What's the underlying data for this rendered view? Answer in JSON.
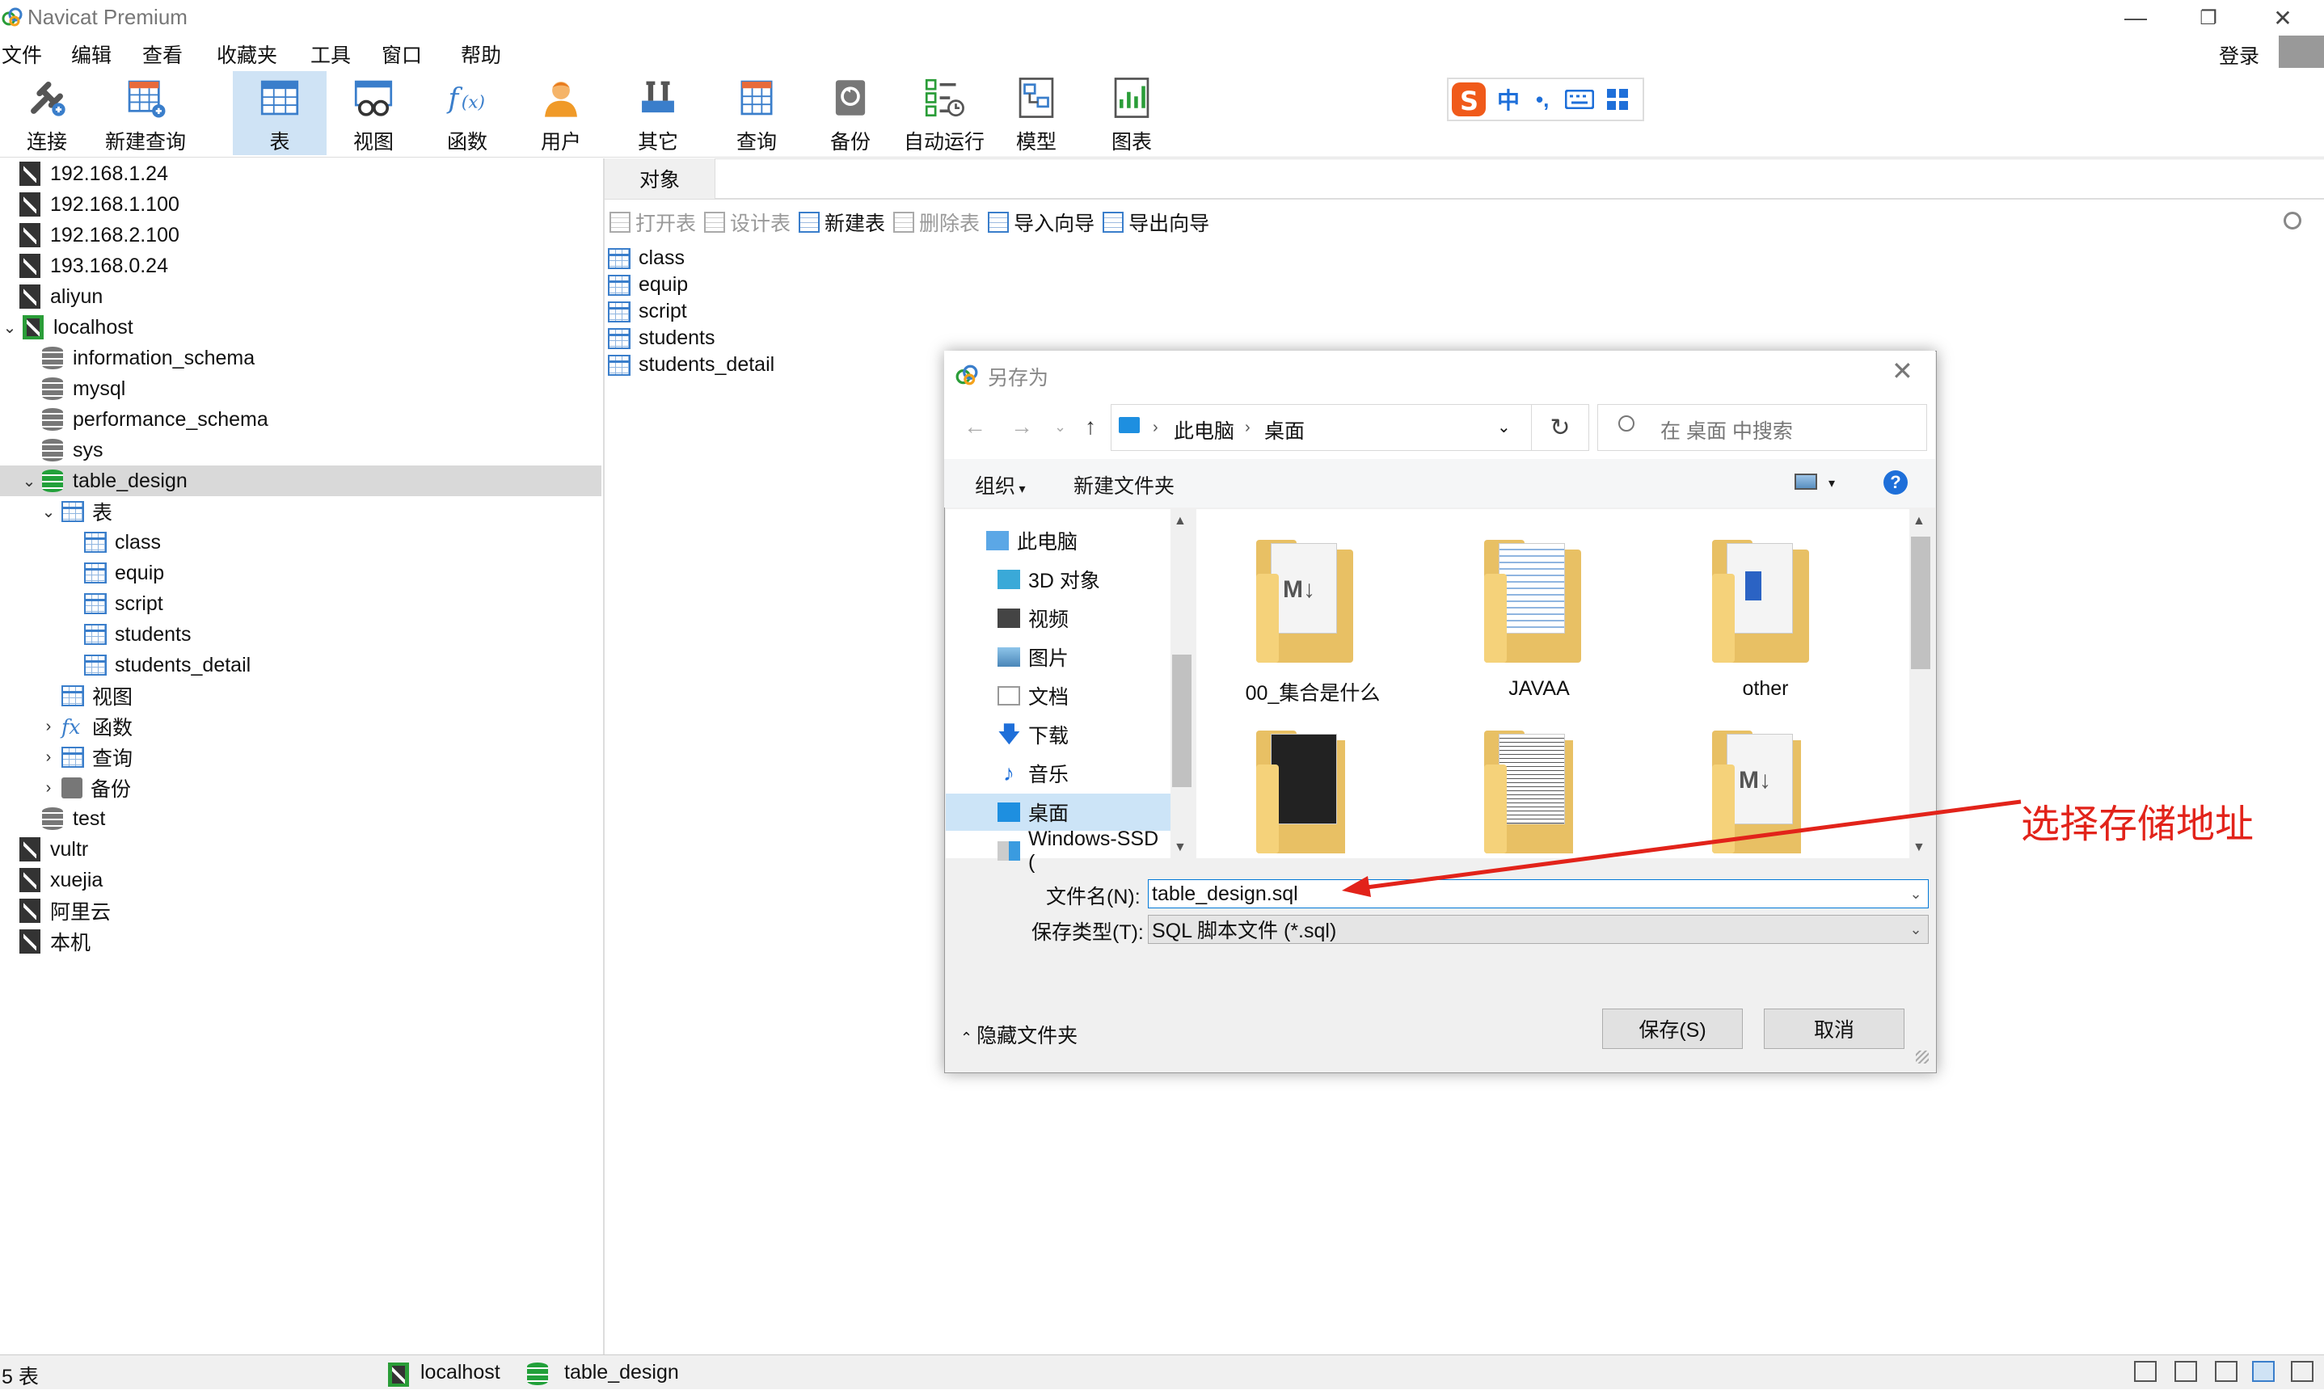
{
  "window": {
    "title": "Navicat Premium",
    "login": "登录"
  },
  "menu": [
    "文件",
    "编辑",
    "查看",
    "收藏夹",
    "工具",
    "窗口",
    "帮助"
  ],
  "toolbar": {
    "connect": "连接",
    "new_query": "新建查询",
    "table": "表",
    "view": "视图",
    "function": "函数",
    "user": "用户",
    "other": "其它",
    "query": "查询",
    "backup": "备份",
    "auto_run": "自动运行",
    "model": "模型",
    "chart": "图表"
  },
  "ime": {
    "mode": "中"
  },
  "sidebar": {
    "connections_top": [
      "192.168.1.24",
      "192.168.1.100",
      "192.168.2.100",
      "193.168.0.24",
      "aliyun",
      "localhost"
    ],
    "databases": [
      "information_schema",
      "mysql",
      "performance_schema",
      "sys",
      "table_design"
    ],
    "tables_label": "表",
    "tables": [
      "class",
      "equip",
      "script",
      "students",
      "students_detail"
    ],
    "views_label": "视图",
    "functions_label": "函数",
    "queries_label": "查询",
    "backups_label": "备份",
    "test_db": "test",
    "connections_bottom": [
      "vultr",
      "xuejia",
      "阿里云",
      "本机"
    ]
  },
  "content": {
    "tab": "对象",
    "actions": {
      "open": "打开表",
      "design": "设计表",
      "new": "新建表",
      "delete": "删除表",
      "import": "导入向导",
      "export": "导出向导"
    },
    "objects": [
      "class",
      "equip",
      "script",
      "students",
      "students_detail"
    ]
  },
  "status": {
    "count": "5 表",
    "connection": "localhost",
    "database": "table_design"
  },
  "dialog": {
    "title": "另存为",
    "breadcrumb": [
      "此电脑",
      "桌面"
    ],
    "search_placeholder": "在 桌面 中搜索",
    "organize": "组织",
    "new_folder": "新建文件夹",
    "nav": [
      "此电脑",
      "3D 对象",
      "视频",
      "图片",
      "文档",
      "下载",
      "音乐",
      "桌面",
      "Windows-SSD ("
    ],
    "files": [
      "00_集合是什么",
      "JAVAA",
      "other"
    ],
    "filename_label": "文件名(N):",
    "filename": "table_design.sql",
    "type_label": "保存类型(T):",
    "type": "SQL 脚本文件 (*.sql)",
    "hide_folders": "隐藏文件夹",
    "save": "保存(S)",
    "cancel": "取消"
  },
  "annotation": "选择存储地址",
  "colors": {
    "accent": "#1e6fd9",
    "annotation": "#e2231a",
    "selected_bg": "#cfe3f5"
  }
}
